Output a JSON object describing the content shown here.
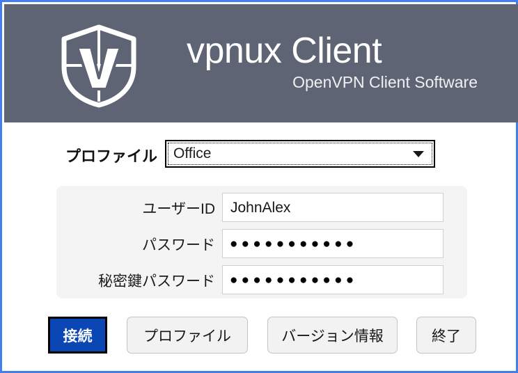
{
  "window": {
    "border_color": "#3f7ff0"
  },
  "header": {
    "background_color": "#5e6473",
    "logo_icon": "shield-v-logo-icon",
    "title": "vpnux Client",
    "subtitle": "OpenVPN Client Software"
  },
  "profile": {
    "label": "プロファイル",
    "selected_value": "Office",
    "dropdown_icon": "chevron-down-icon",
    "focused": true
  },
  "credentials": {
    "rows": [
      {
        "label": "ユーザーID",
        "value": "JohnAlex",
        "masked": false
      },
      {
        "label": "パスワード",
        "value": "●●●●●●●●●●●",
        "masked": true
      },
      {
        "label": "秘密鍵パスワード",
        "value": "●●●●●●●●●●●",
        "masked": true
      }
    ]
  },
  "buttons": {
    "connect": "接続",
    "profile": "プロファイル",
    "version": "バージョン情報",
    "exit": "終了",
    "connect_color": "#0a47b5",
    "default_color": "#f2f2f2"
  }
}
